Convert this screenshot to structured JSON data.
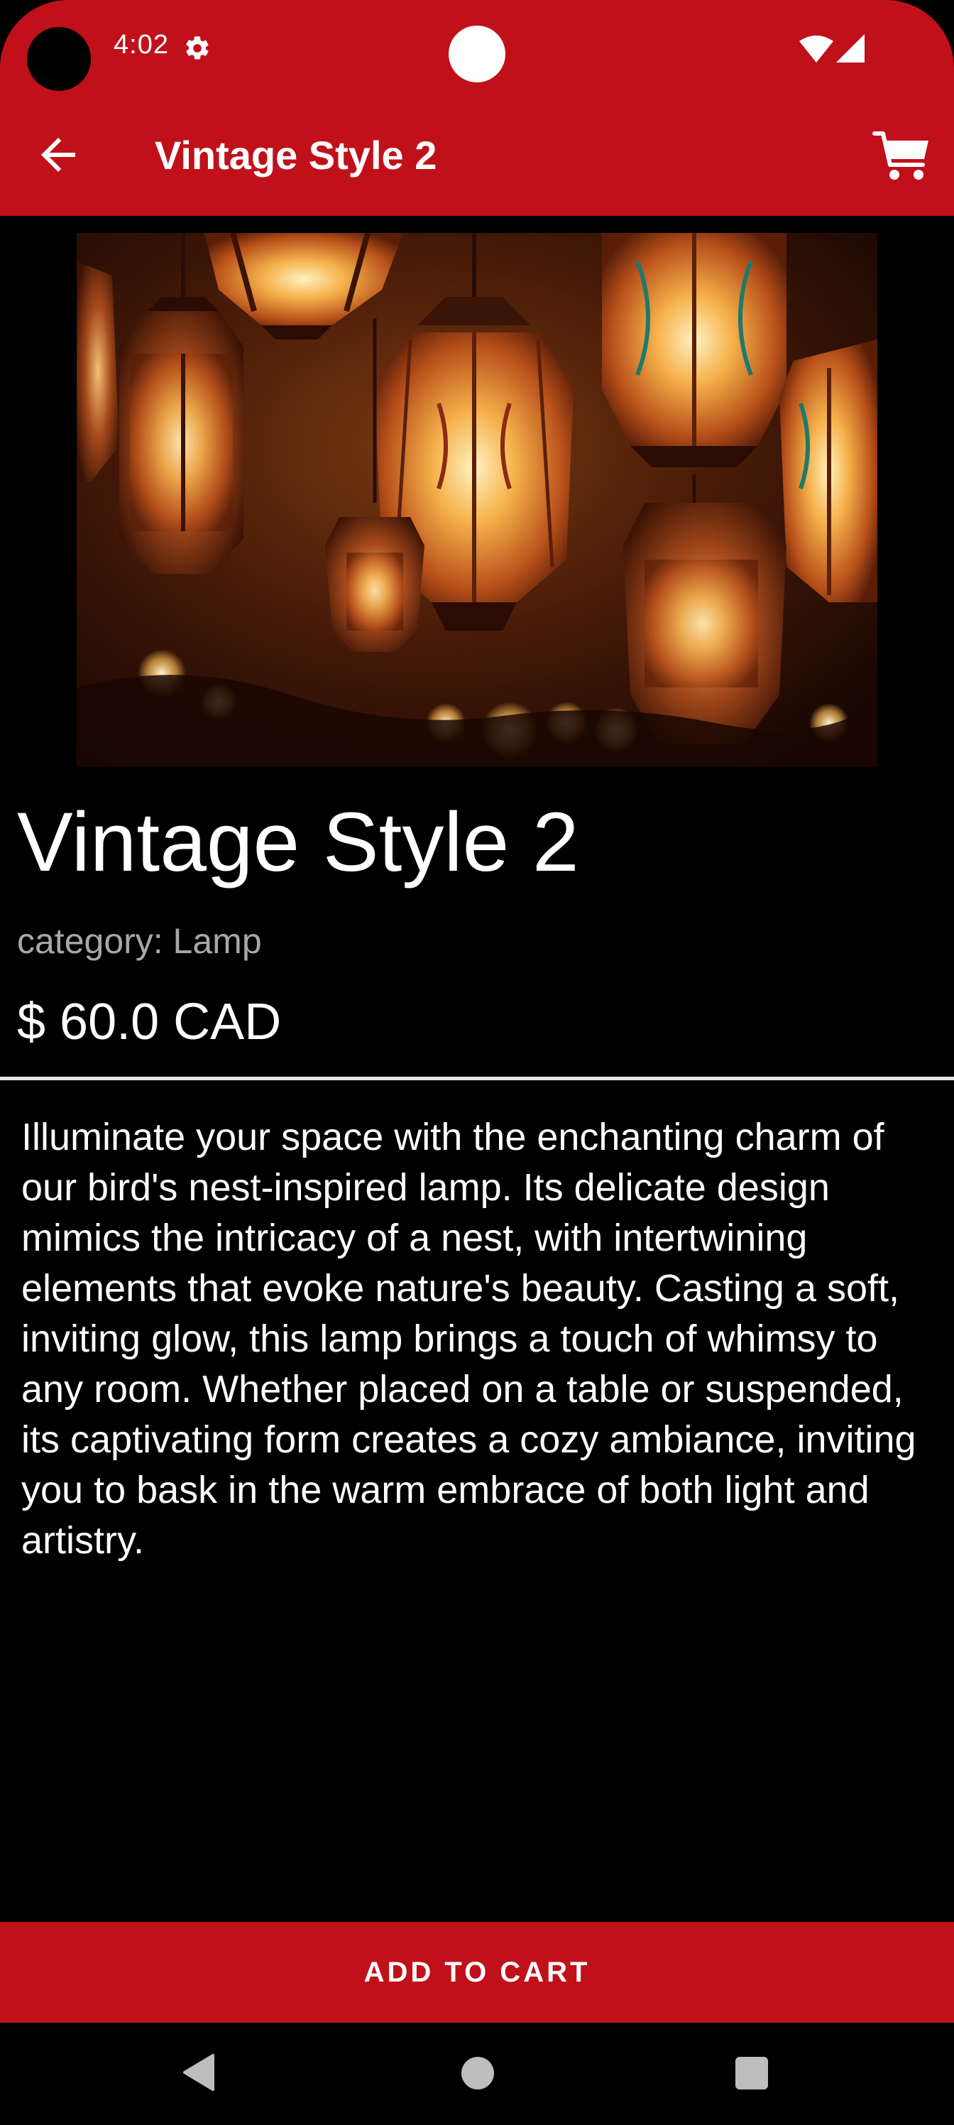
{
  "status_bar": {
    "time": "4:02",
    "icons": [
      "gear-icon",
      "wifi-icon",
      "signal-icon"
    ]
  },
  "app_bar": {
    "title": "Vintage Style 2",
    "back_icon": "arrow-left-icon",
    "cart_icon": "cart-icon"
  },
  "product": {
    "name": "Vintage Style 2",
    "category": "category: Lamp",
    "price": "$ 60.0 CAD",
    "description": "Illuminate your space with the enchanting charm of our bird's nest-inspired lamp. Its delicate design mimics the intricacy of a nest, with intertwining elements that evoke nature's beauty. Casting a soft, inviting glow, this lamp brings a touch of whimsy to any room. Whether placed on a table or suspended, its captivating form creates a cozy ambiance, inviting you to bask in the warm embrace of both light and artistry."
  },
  "actions": {
    "add_to_cart_label": "ADD TO CART"
  },
  "nav_bar": {
    "icons": [
      "back-triangle-icon",
      "home-circle-icon",
      "recents-square-icon"
    ]
  },
  "colors": {
    "primary": "#c0111b",
    "background": "#000000",
    "text": "#ffffff",
    "secondary_text": "#a8a8a8"
  }
}
